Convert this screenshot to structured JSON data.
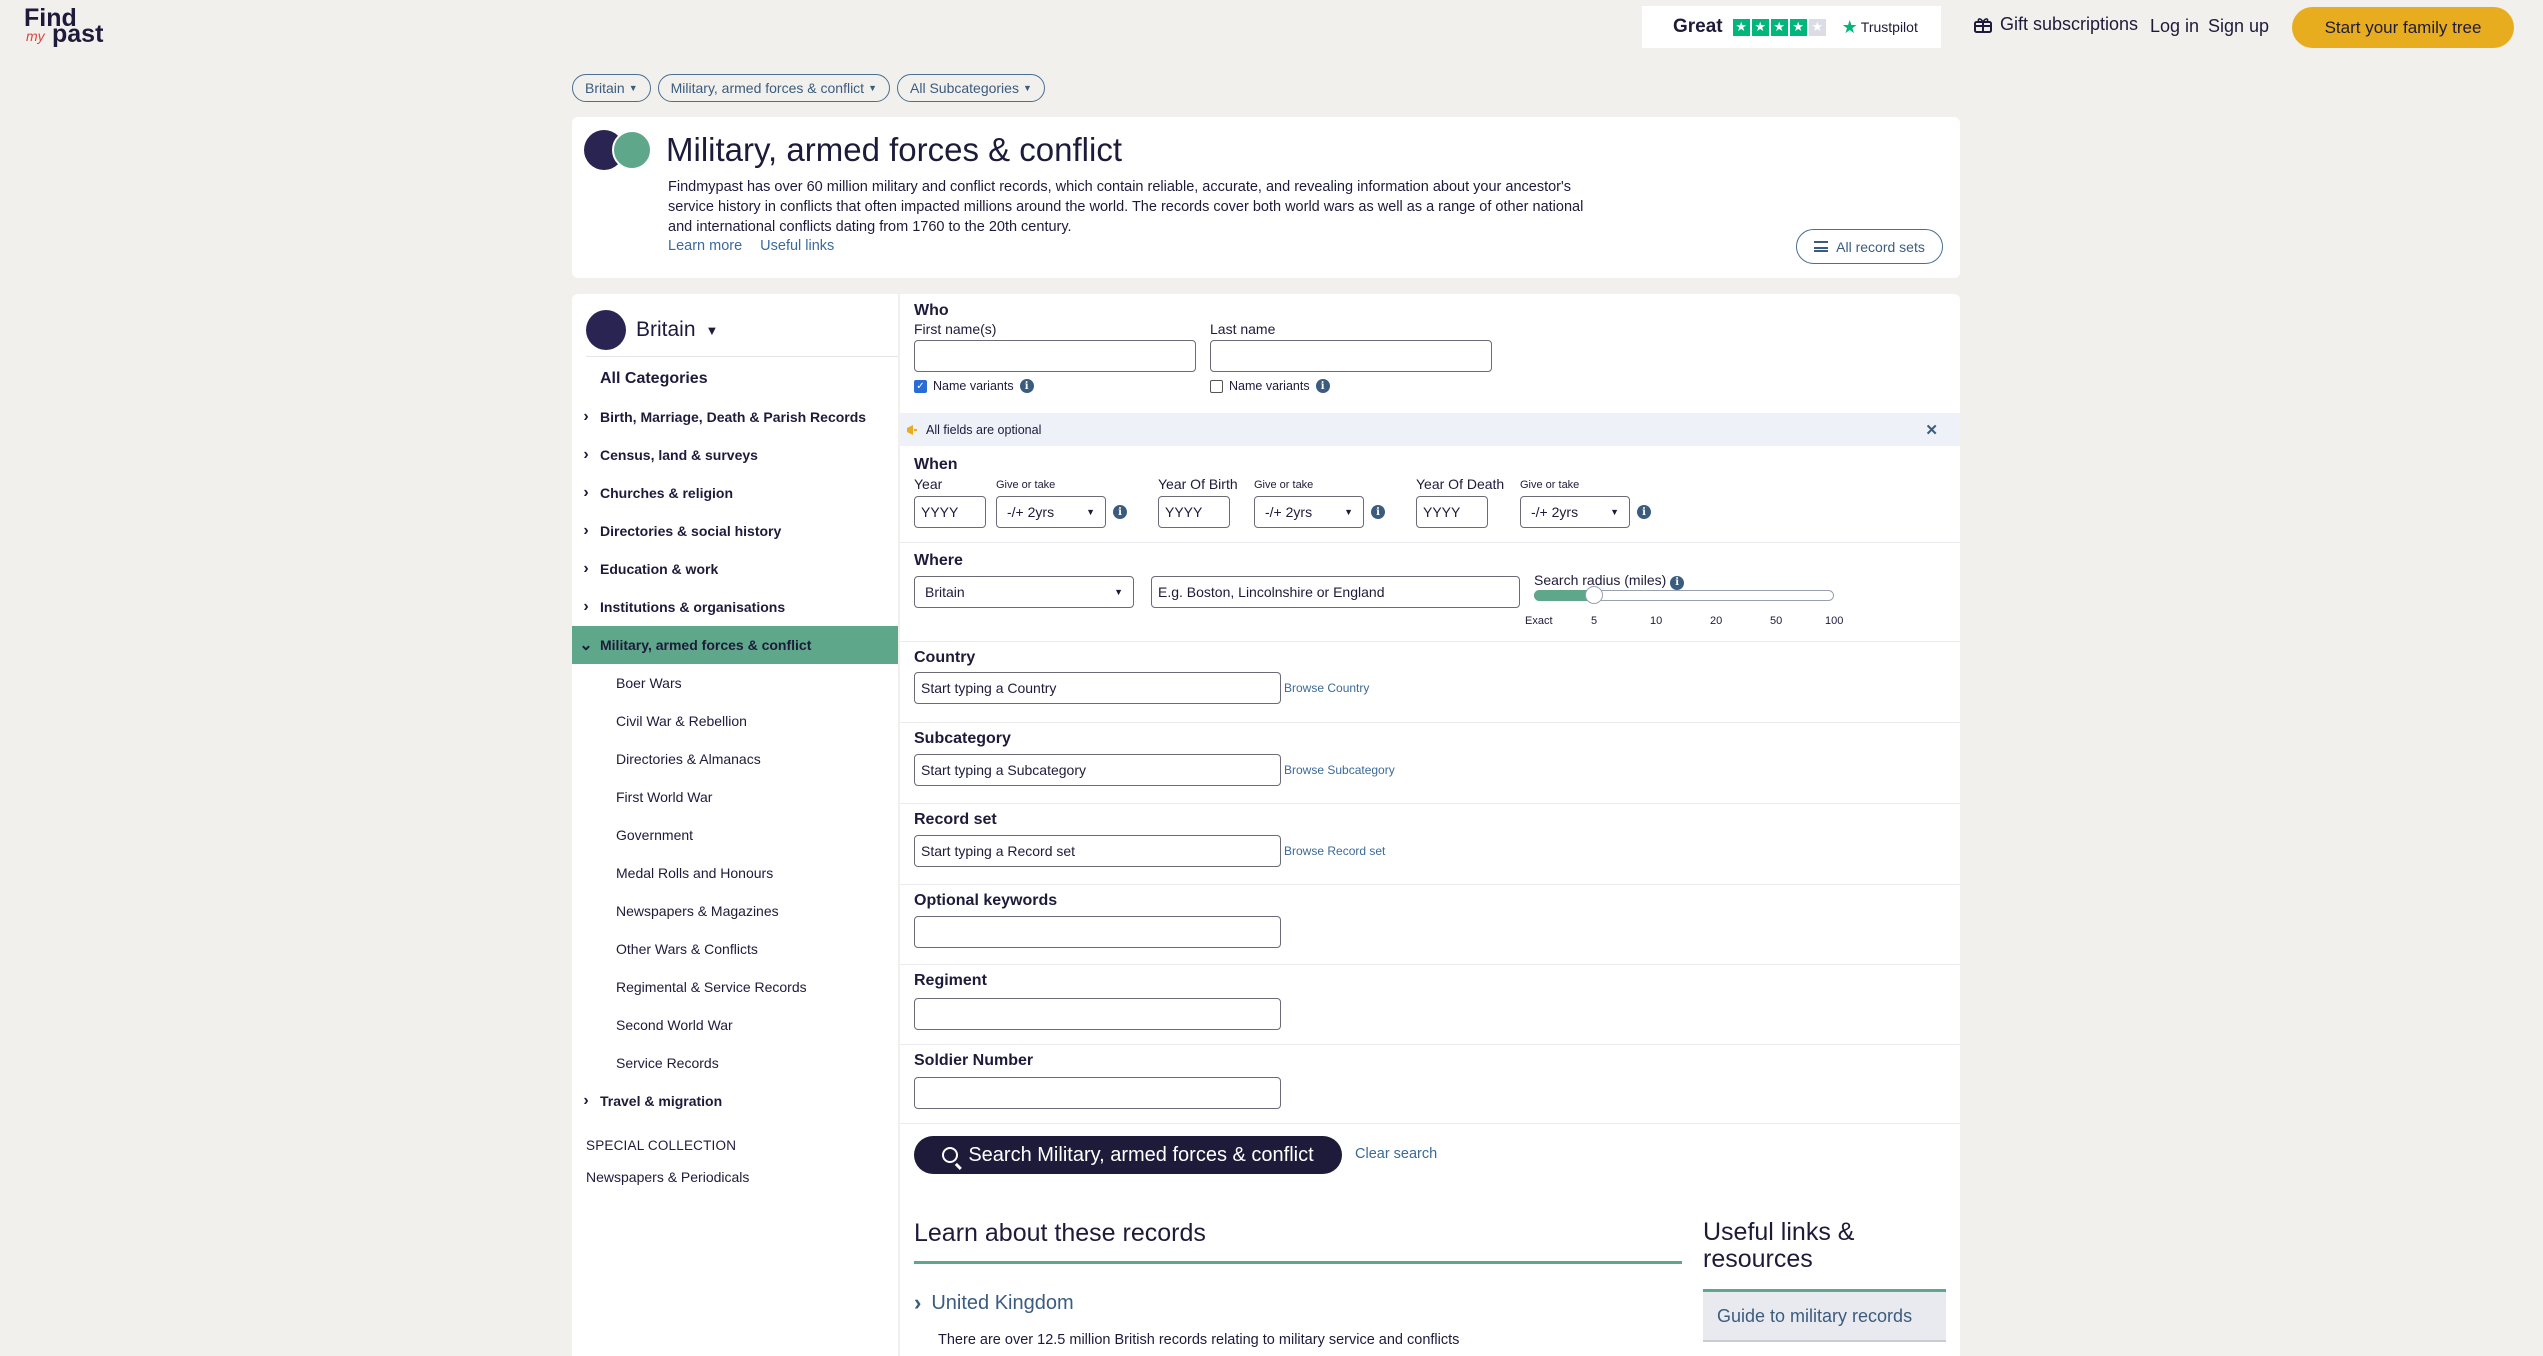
{
  "header": {
    "logo_find": "Find",
    "logo_my": "my",
    "logo_past": "past",
    "trust_rating": "Great",
    "trust_stars": 4,
    "trust_brand": "Trustpilot",
    "gift": "Gift subscriptions",
    "login": "Log in",
    "signup": "Sign up",
    "cta": "Start your family tree"
  },
  "filters": [
    "Britain",
    "Military, armed forces & conflict",
    "All Subcategories"
  ],
  "intro": {
    "title": "Military, armed forces & conflict",
    "description": "Findmypast has over 60 million military and conflict records, which contain reliable, accurate, and revealing information about your ancestor's service history in conflicts that often impacted millions around the world. The records cover both world wars as well as a range of other national and international conflicts dating from 1760 to the 20th century.",
    "learn_more": "Learn more",
    "useful_links": "Useful links",
    "all_record_sets": "All record sets"
  },
  "sidebar": {
    "region": "Britain",
    "all_categories": "All Categories",
    "categories": [
      "Birth, Marriage, Death & Parish Records",
      "Census, land & surveys",
      "Churches & religion",
      "Directories & social history",
      "Education & work",
      "Institutions & organisations",
      "Military, armed forces & conflict"
    ],
    "subcategories": [
      "Boer Wars",
      "Civil War & Rebellion",
      "Directories & Almanacs",
      "First World War",
      "Government",
      "Medal Rolls and Honours",
      "Newspapers & Magazines",
      "Other Wars & Conflicts",
      "Regimental & Service Records",
      "Second World War",
      "Service Records"
    ],
    "after_category": "Travel & migration",
    "special_heading": "SPECIAL COLLECTION",
    "special_link": "Newspapers & Periodicals"
  },
  "form": {
    "who": "Who",
    "first_name_label": "First name(s)",
    "last_name_label": "Last name",
    "name_variants": "Name variants",
    "notice": "All fields are optional",
    "when": "When",
    "year_label": "Year",
    "give_or_take": "Give or take",
    "yob_label": "Year Of Birth",
    "yod_label": "Year Of Death",
    "year_placeholder": "YYYY",
    "range_value": "-/+ 2yrs",
    "where": "Where",
    "where_select": "Britain",
    "where_placeholder": "E.g. Boston, Lincolnshire or England",
    "radius_label": "Search radius (miles)",
    "radius_ticks": [
      "Exact",
      "5",
      "10",
      "20",
      "50",
      "100"
    ],
    "radius_value_fraction": 0.2,
    "country_label": "Country",
    "country_placeholder": "Start typing a Country",
    "browse_country": "Browse Country",
    "subcategory_label": "Subcategory",
    "subcategory_placeholder": "Start typing a Subcategory",
    "browse_subcategory": "Browse Subcategory",
    "recordset_label": "Record set",
    "recordset_placeholder": "Start typing a Record set",
    "browse_recordset": "Browse Record set",
    "keywords_label": "Optional keywords",
    "regiment_label": "Regiment",
    "soldier_label": "Soldier Number",
    "search_button": "Search Military, armed forces & conflict",
    "clear": "Clear search"
  },
  "learn": {
    "heading": "Learn about these records",
    "uk": "United Kingdom",
    "uk_text": "There are over 12.5 million British records relating to military service and conflicts",
    "useful_heading": "Useful links & resources",
    "guide": "Guide to military records"
  },
  "colors": {
    "accent": "#5ea78a",
    "brand_dark": "#1e1b3a",
    "cta": "#e8ad1f",
    "link": "#3b6a9a"
  }
}
